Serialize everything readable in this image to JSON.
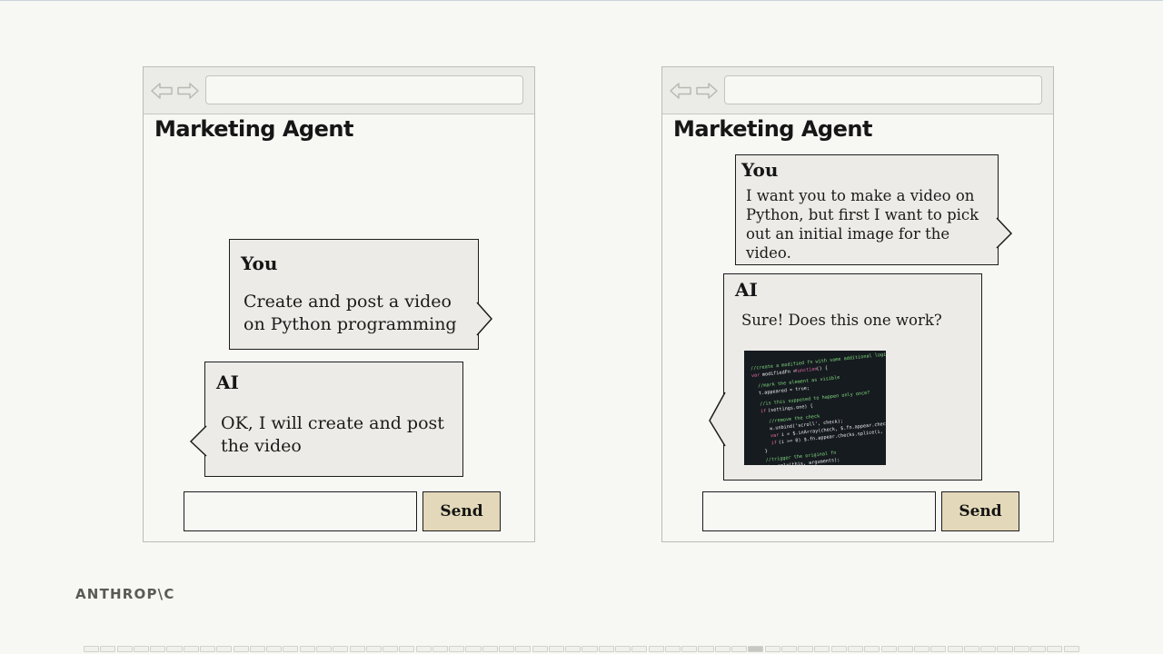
{
  "brand": {
    "logo_text": "ANTHROP\\C"
  },
  "colors": {
    "page_bg": "#f7f7f3",
    "bubble_bg": "#edebe7",
    "send_button_bg": "#e3d8b9",
    "border": "#1d1d1d"
  },
  "icons": {
    "back": "back-arrow-icon",
    "forward": "forward-arrow-icon"
  },
  "windows": [
    {
      "title": "Marketing Agent",
      "address": "",
      "messages": [
        {
          "sender": "You",
          "text": "Create and post a video on Python programming"
        },
        {
          "sender": "AI",
          "text": "OK, I will create and post the video"
        }
      ],
      "input_value": "",
      "send_label": "Send"
    },
    {
      "title": "Marketing Agent",
      "address": "",
      "messages": [
        {
          "sender": "You",
          "text": "I want you to make a video on Python, but first I want to pick out an initial image for the video."
        },
        {
          "sender": "AI",
          "text": "Sure! Does this one work?",
          "attachment": "code-screenshot-image"
        }
      ],
      "input_value": "",
      "send_label": "Send"
    }
  ],
  "pagination": {
    "total": 60,
    "current": 41
  }
}
